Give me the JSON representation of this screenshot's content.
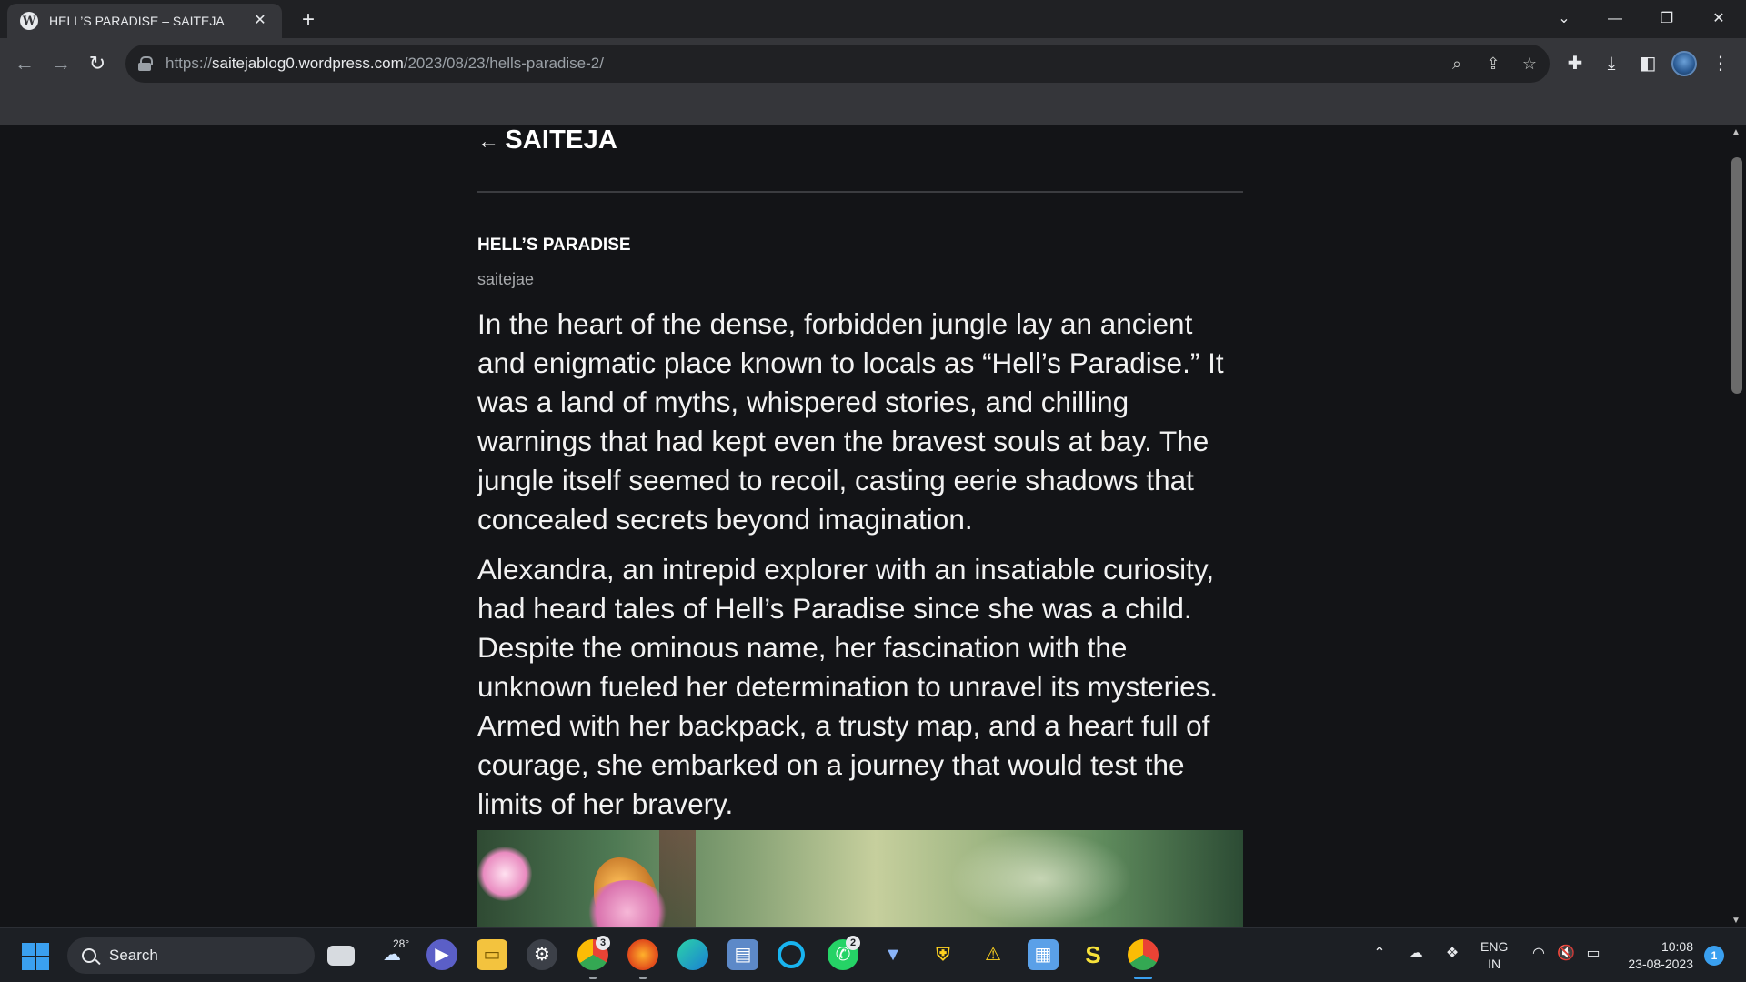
{
  "browser": {
    "tab_title": "HELL’S PARADISE – SAITEJA",
    "favicon_letter": "W",
    "url_scheme": "https://",
    "url_host": "saitejablog0.wordpress.com",
    "url_path": "/2023/08/23/hells-paradise-2/"
  },
  "site": {
    "back_arrow": "←",
    "title": "SAITEJA"
  },
  "post": {
    "title": "HELL’S PARADISE",
    "author": "saitejae",
    "paragraphs": [
      "In the heart of the dense, forbidden jungle lay an ancient and enigmatic place known to locals as “Hell’s Paradise.” It was a land of myths, whispered stories, and chilling warnings that had kept even the bravest souls at bay. The jungle itself seemed to recoil, casting eerie shadows that concealed secrets beyond imagination.",
      "Alexandra, an intrepid explorer with an insatiable curiosity, had heard tales of Hell’s Paradise since she was a child. Despite the ominous name, her fascination with the unknown fueled her determination to unravel its mysteries. Armed with her backpack, a trusty map, and a heart full of courage, she embarked on a journey that would test the limits of her bravery."
    ]
  },
  "taskbar": {
    "search_placeholder": "Search",
    "weather_temp": "28°",
    "chrome_badge": "3",
    "whatsapp_badge": "2",
    "language_line1": "ENG",
    "language_line2": "IN",
    "time": "10:08",
    "date": "23-08-2023",
    "notification_count": "1"
  },
  "colors": {
    "page_bg": "#131417",
    "accent": "#3aa0f0",
    "chrome_dark": "#202124",
    "chrome_toolbar": "#35363a"
  }
}
